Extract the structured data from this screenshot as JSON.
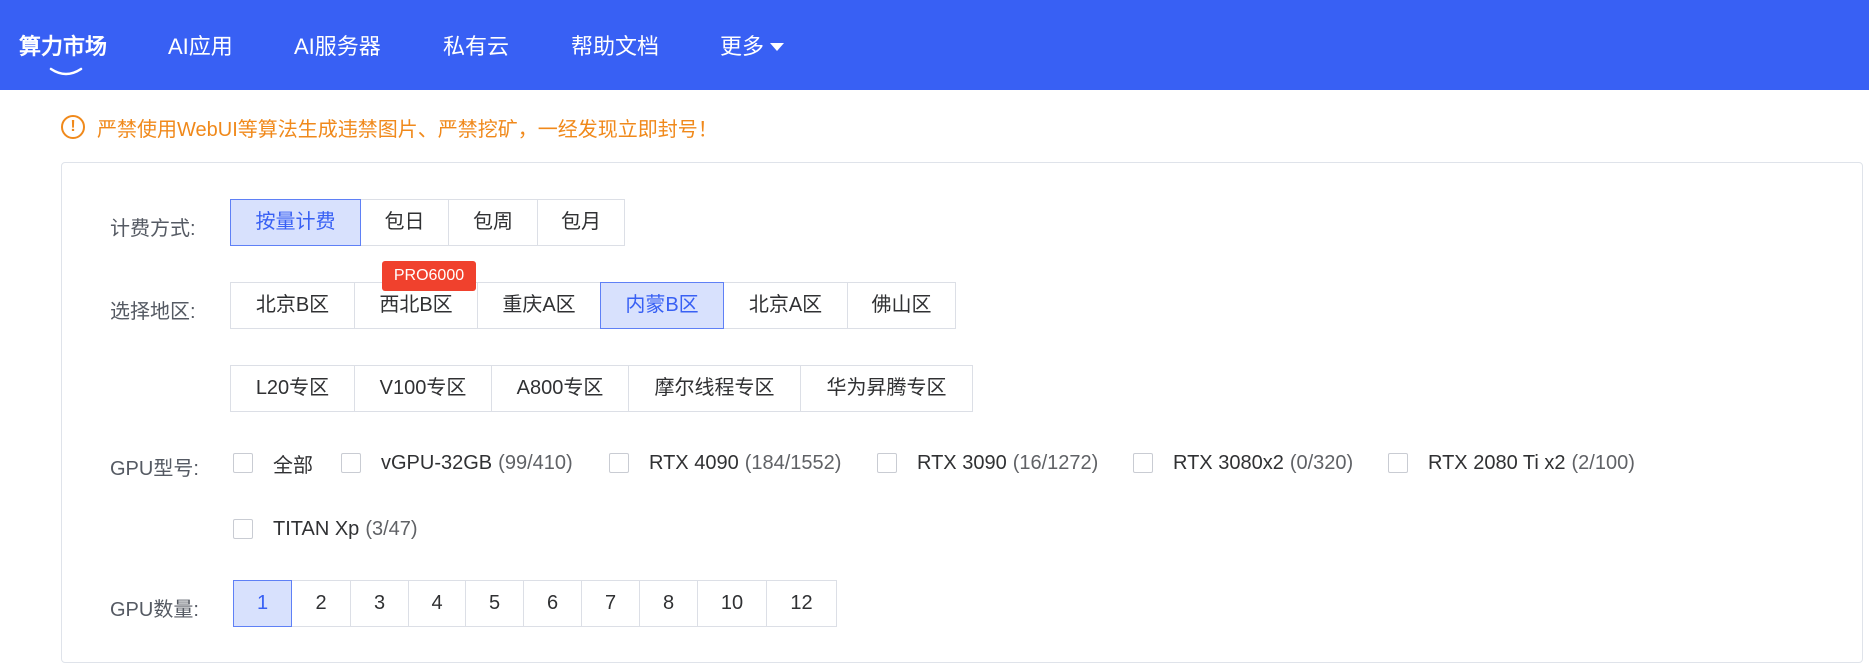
{
  "nav": {
    "items": [
      {
        "label": "算力市场"
      },
      {
        "label": "AI应用"
      },
      {
        "label": "AI服务器"
      },
      {
        "label": "私有云"
      },
      {
        "label": "帮助文档"
      },
      {
        "label": "更多"
      }
    ]
  },
  "notice": {
    "icon": "!",
    "text": "严禁使用WebUI等算法生成违禁图片、严禁挖矿，一经发现立即封号！"
  },
  "billing": {
    "label": "计费方式:",
    "options": [
      "按量计费",
      "包日",
      "包周",
      "包月"
    ],
    "selected": "按量计费"
  },
  "region": {
    "label": "选择地区:",
    "row1": [
      "北京B区",
      "西北B区",
      "重庆A区",
      "内蒙B区",
      "北京A区",
      "佛山区"
    ],
    "row2": [
      "L20专区",
      "V100专区",
      "A800专区",
      "摩尔线程专区",
      "华为昇腾专区"
    ],
    "selected": "内蒙B区",
    "badge": "PRO6000"
  },
  "gpu_model": {
    "label": "GPU型号:",
    "options": [
      {
        "name": "全部",
        "count": ""
      },
      {
        "name": "vGPU-32GB",
        "count": "(99/410)"
      },
      {
        "name": "RTX 4090",
        "count": "(184/1552)"
      },
      {
        "name": "RTX 3090",
        "count": "(16/1272)"
      },
      {
        "name": "RTX 3080x2",
        "count": "(0/320)"
      },
      {
        "name": "RTX 2080 Ti x2",
        "count": "(2/100)"
      },
      {
        "name": "TITAN Xp",
        "count": "(3/47)"
      }
    ]
  },
  "gpu_count": {
    "label": "GPU数量:",
    "options": [
      "1",
      "2",
      "3",
      "4",
      "5",
      "6",
      "7",
      "8",
      "10",
      "12"
    ],
    "selected": "1"
  },
  "colors": {
    "brand": "#3860f4",
    "warning": "#f0891b",
    "badge": "#f0412d",
    "selected_bg": "#d8e1fd"
  }
}
